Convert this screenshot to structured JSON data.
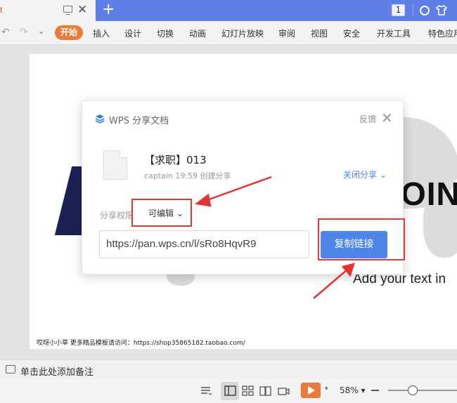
{
  "titlebar": {
    "doc_tab_label": "t",
    "tab_close": "✕",
    "new_tab": "+",
    "page_badge": "1"
  },
  "ribbon": {
    "undo": "↶",
    "redo": "↷",
    "quick_access": "⌄",
    "menu": [
      "开始",
      "插入",
      "设计",
      "切换",
      "动画",
      "幻灯片放映",
      "审阅",
      "视图",
      "安全",
      "开发工具",
      "特色应用"
    ]
  },
  "slide": {
    "big_text": "OINT",
    "subtitle": "Add your text in",
    "footer": "哎呀小小草 更多精品模板请访问：https://shop35865182.taobao.com/"
  },
  "dialog": {
    "title": "WPS 分享文档",
    "feedback": "反馈",
    "close": "✕",
    "file_name": "【求职】013",
    "file_meta": "captain 19:59 创建分享",
    "close_share": "关闭分享",
    "close_share_caret": "⌄",
    "permission_label": "分享权限",
    "permission_value": "可编辑",
    "permission_caret": "⌄",
    "url": "https://pan.wps.cn/l/sRo8HqvR9",
    "copy_button": "复制链接"
  },
  "notes": {
    "placeholder": "单击此处添加备注"
  },
  "status": {
    "play_caret": "▾",
    "zoom": "58%",
    "zoom_caret": "▾"
  },
  "colors": {
    "title_bar": "#5f7ee8",
    "accent_orange": "#ea7b3b",
    "primary_blue": "#4d86e6",
    "annotation_red": "#e33333"
  }
}
